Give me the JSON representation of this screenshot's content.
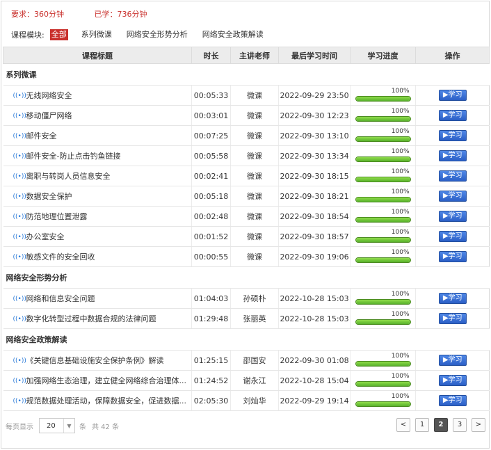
{
  "summary": {
    "required": "要求：360分钟",
    "learned": "已学：736分钟"
  },
  "modules": {
    "label": "课程模块:",
    "tabs": [
      "全部",
      "系列微课",
      "网络安全形势分析",
      "网络安全政策解读"
    ],
    "active": 0
  },
  "table": {
    "headers": [
      "课程标题",
      "时长",
      "主讲老师",
      "最后学习时间",
      "学习进度",
      "操作"
    ],
    "groups": [
      {
        "name": "系列微课",
        "rows": [
          {
            "title": "无线网络安全",
            "duration": "00:05:33",
            "teacher": "微课",
            "last": "2022-09-29 23:50",
            "progress": "100%",
            "action": "学习"
          },
          {
            "title": "移动僵尸网络",
            "duration": "00:03:01",
            "teacher": "微课",
            "last": "2022-09-30 12:23",
            "progress": "100%",
            "action": "学习"
          },
          {
            "title": "邮件安全",
            "duration": "00:07:25",
            "teacher": "微课",
            "last": "2022-09-30 13:10",
            "progress": "100%",
            "action": "学习"
          },
          {
            "title": "邮件安全-防止点击钓鱼链接",
            "duration": "00:05:58",
            "teacher": "微课",
            "last": "2022-09-30 13:34",
            "progress": "100%",
            "action": "学习"
          },
          {
            "title": "离职与转岗人员信息安全",
            "duration": "00:02:41",
            "teacher": "微课",
            "last": "2022-09-30 18:15",
            "progress": "100%",
            "action": "学习"
          },
          {
            "title": "数据安全保护",
            "duration": "00:05:18",
            "teacher": "微课",
            "last": "2022-09-30 18:21",
            "progress": "100%",
            "action": "学习"
          },
          {
            "title": "防范地理位置泄露",
            "duration": "00:02:48",
            "teacher": "微课",
            "last": "2022-09-30 18:54",
            "progress": "100%",
            "action": "学习"
          },
          {
            "title": "办公室安全",
            "duration": "00:01:52",
            "teacher": "微课",
            "last": "2022-09-30 18:57",
            "progress": "100%",
            "action": "学习"
          },
          {
            "title": "敏感文件的安全回收",
            "duration": "00:00:55",
            "teacher": "微课",
            "last": "2022-09-30 19:06",
            "progress": "100%",
            "action": "学习"
          }
        ]
      },
      {
        "name": "网络安全形势分析",
        "rows": [
          {
            "title": "网络和信息安全问题",
            "duration": "01:04:03",
            "teacher": "孙硕朴",
            "last": "2022-10-28 15:03",
            "progress": "100%",
            "action": "学习"
          },
          {
            "title": "数字化转型过程中数据合规的法律问题",
            "duration": "01:29:48",
            "teacher": "张丽英",
            "last": "2022-10-28 15:03",
            "progress": "100%",
            "action": "学习"
          }
        ]
      },
      {
        "name": "网络安全政策解读",
        "rows": [
          {
            "title": "《关键信息基础设施安全保护条例》解读",
            "duration": "01:25:15",
            "teacher": "邵国安",
            "last": "2022-09-30 01:08",
            "progress": "100%",
            "action": "学习"
          },
          {
            "title": "加强网络生态治理，建立健全网络综合治理体...",
            "duration": "01:24:52",
            "teacher": "谢永江",
            "last": "2022-10-28 15:04",
            "progress": "100%",
            "action": "学习"
          },
          {
            "title": "规范数据处理活动，保障数据安全，促进数据...",
            "duration": "02:05:30",
            "teacher": "刘灿华",
            "last": "2022-09-29 19:14",
            "progress": "100%",
            "action": "学习"
          }
        ]
      }
    ]
  },
  "footer": {
    "per_page_label": "每页显示",
    "per_page_value": "20",
    "unit": "条",
    "total": "共 42 条",
    "pages": [
      "<",
      "1",
      "2",
      "3",
      ">"
    ],
    "current_page": "2"
  },
  "colors": {
    "accent_red": "#c9302c",
    "button_blue": "#2b5fc6",
    "progress_green": "#58b12c"
  },
  "icons": {
    "course": "wireless-icon",
    "select_arrow": "chevron-down-icon"
  }
}
